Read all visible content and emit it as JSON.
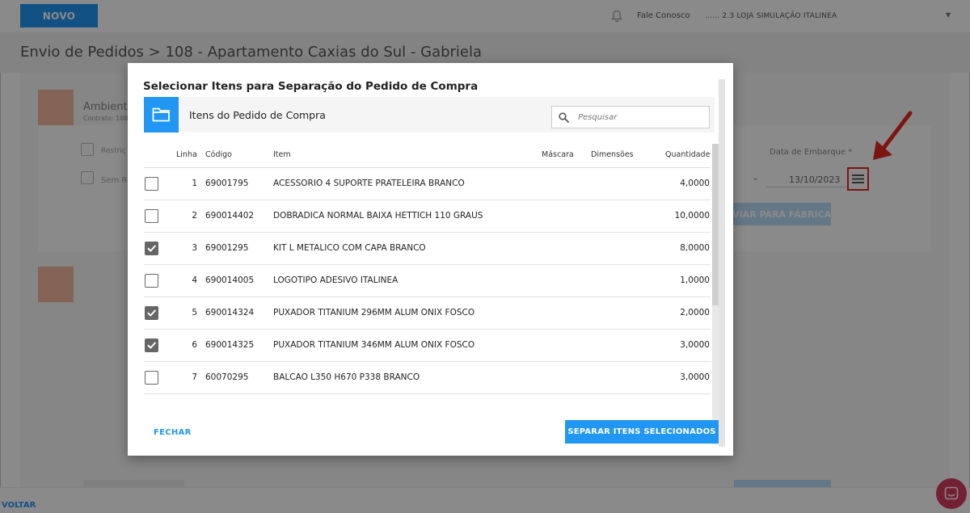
{
  "topbar": {
    "novo_label": "NOVO",
    "help_label": "Fale Conosco",
    "store_label": "...... 2.3 LOJA SIMULAÇÃO ITALINEA"
  },
  "page": {
    "title": "Envio de Pedidos > 108 - Apartamento Caxias do Sul - Gabriela",
    "card": {
      "heading": "Ambiente",
      "contract": "Contrato: 108",
      "restriction_label": "Restriç",
      "semr_label": "Sem R",
      "ship_date_label": "Data de Embarque *",
      "ship_date_value": "13/10/2023",
      "send_button": "IVIAR PARA FÁBRICA"
    },
    "back_label": "VOLTAR"
  },
  "modal": {
    "title": "Selecionar Itens para Separação do Pedido de Compra",
    "section_title": "Itens do Pedido de Compra",
    "search_placeholder": "Pesquisar",
    "columns": {
      "linha": "Linha",
      "codigo": "Código",
      "item": "Item",
      "mascara": "Máscara",
      "dimensoes": "Dimensões",
      "quantidade": "Quantidade"
    },
    "rows": [
      {
        "linha": "1",
        "codigo": "69001795",
        "item": "ACESSORIO 4 SUPORTE PRATELEIRA BRANCO",
        "quantidade": "4,0000",
        "checked": false
      },
      {
        "linha": "2",
        "codigo": "690014402",
        "item": "DOBRADICA NORMAL BAIXA HETTICH 110 GRAUS",
        "quantidade": "10,0000",
        "checked": false
      },
      {
        "linha": "3",
        "codigo": "69001295",
        "item": "KIT L METALICO COM CAPA BRANCO",
        "quantidade": "8,0000",
        "checked": true
      },
      {
        "linha": "4",
        "codigo": "690014005",
        "item": "LOGOTIPO ADESIVO ITALINEA",
        "quantidade": "1,0000",
        "checked": false
      },
      {
        "linha": "5",
        "codigo": "690014324",
        "item": "PUXADOR TITANIUM 296MM ALUM ONIX FOSCO",
        "quantidade": "2,0000",
        "checked": true
      },
      {
        "linha": "6",
        "codigo": "690014325",
        "item": "PUXADOR TITANIUM 346MM ALUM ONIX FOSCO",
        "quantidade": "3,0000",
        "checked": true
      },
      {
        "linha": "7",
        "codigo": "60070295",
        "item": "BALCAO L350 H670 P338 BRANCO",
        "quantidade": "3,0000",
        "checked": false
      }
    ],
    "close_button": "FECHAR",
    "submit_button": "SEPARAR ITENS SELECIONADOS"
  },
  "colors": {
    "primary": "#2196f3",
    "highlight": "#e52620",
    "chat": "#d63c5e"
  }
}
